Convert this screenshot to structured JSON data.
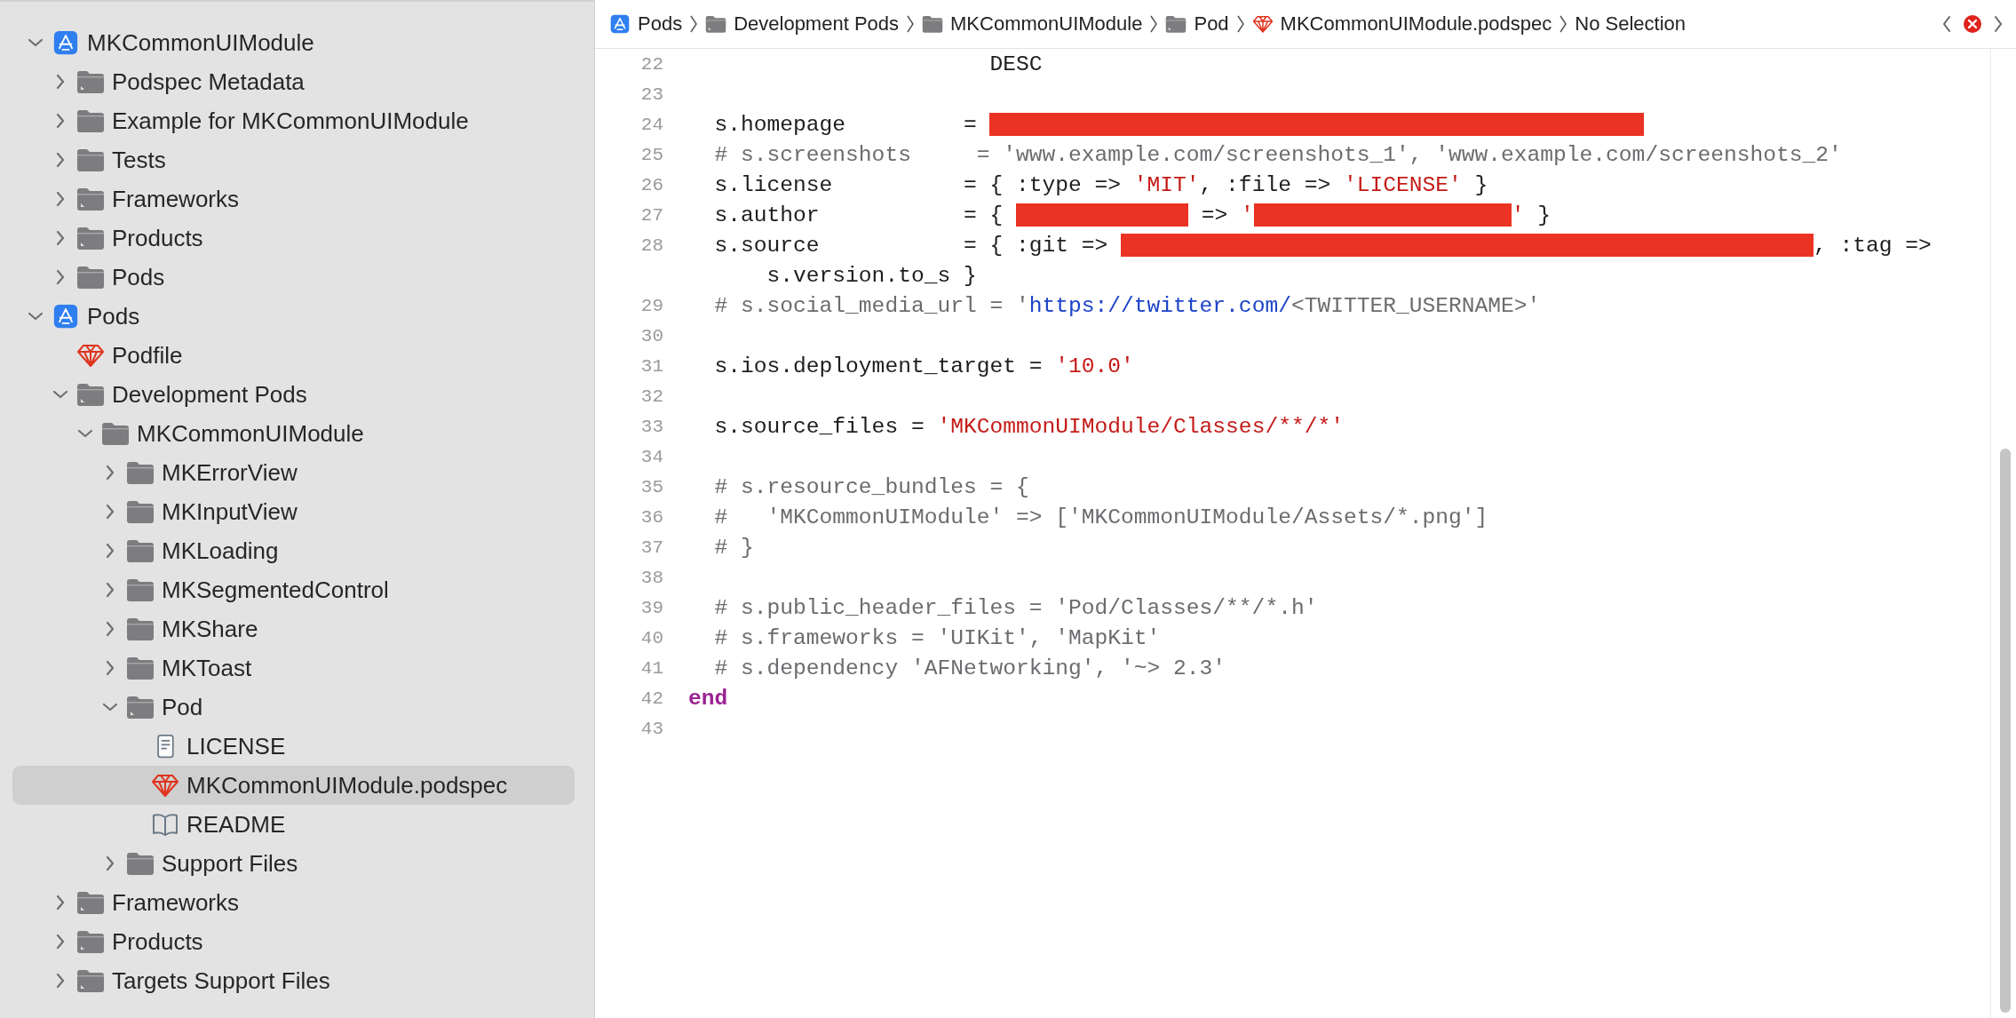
{
  "navigator": {
    "items": [
      {
        "label": "MKCommonUIModule",
        "kind": "project",
        "expanded": true,
        "selected": false,
        "children": [
          {
            "label": "Podspec Metadata",
            "kind": "group",
            "expanded": false,
            "selected": false
          },
          {
            "label": "Example for MKCommonUIModule",
            "kind": "folder",
            "expanded": false,
            "selected": false
          },
          {
            "label": "Tests",
            "kind": "folder",
            "expanded": false,
            "selected": false
          },
          {
            "label": "Frameworks",
            "kind": "group",
            "expanded": false,
            "selected": false
          },
          {
            "label": "Products",
            "kind": "group",
            "expanded": false,
            "selected": false
          },
          {
            "label": "Pods",
            "kind": "folder",
            "expanded": false,
            "selected": false
          }
        ]
      },
      {
        "label": "Pods",
        "kind": "project",
        "expanded": true,
        "selected": false,
        "children": [
          {
            "label": "Podfile",
            "kind": "ruby",
            "selected": false
          },
          {
            "label": "Development Pods",
            "kind": "group",
            "expanded": true,
            "selected": false,
            "children": [
              {
                "label": "MKCommonUIModule",
                "kind": "folder",
                "expanded": true,
                "selected": false,
                "children": [
                  {
                    "label": "MKErrorView",
                    "kind": "folder",
                    "expanded": false,
                    "selected": false
                  },
                  {
                    "label": "MKInputView",
                    "kind": "folder",
                    "expanded": false,
                    "selected": false
                  },
                  {
                    "label": "MKLoading",
                    "kind": "folder",
                    "expanded": false,
                    "selected": false
                  },
                  {
                    "label": "MKSegmentedControl",
                    "kind": "folder",
                    "expanded": false,
                    "selected": false
                  },
                  {
                    "label": "MKShare",
                    "kind": "folder",
                    "expanded": false,
                    "selected": false
                  },
                  {
                    "label": "MKToast",
                    "kind": "folder",
                    "expanded": false,
                    "selected": false
                  },
                  {
                    "label": "Pod",
                    "kind": "group",
                    "expanded": true,
                    "selected": false,
                    "children": [
                      {
                        "label": "LICENSE",
                        "kind": "text",
                        "selected": false
                      },
                      {
                        "label": "MKCommonUIModule.podspec",
                        "kind": "ruby",
                        "selected": true
                      },
                      {
                        "label": "README",
                        "kind": "book",
                        "selected": false
                      }
                    ]
                  },
                  {
                    "label": "Support Files",
                    "kind": "folder",
                    "expanded": false,
                    "selected": false
                  }
                ]
              }
            ]
          },
          {
            "label": "Frameworks",
            "kind": "group",
            "expanded": false,
            "selected": false
          },
          {
            "label": "Products",
            "kind": "group",
            "expanded": false,
            "selected": false
          },
          {
            "label": "Targets Support Files",
            "kind": "group",
            "expanded": false,
            "selected": false
          }
        ]
      }
    ]
  },
  "jump_bar": {
    "path": [
      {
        "label": "Pods",
        "kind": "project"
      },
      {
        "label": "Development Pods",
        "kind": "group"
      },
      {
        "label": "MKCommonUIModule",
        "kind": "folder"
      },
      {
        "label": "Pod",
        "kind": "group"
      },
      {
        "label": "MKCommonUIModule.podspec",
        "kind": "ruby"
      },
      {
        "label": "No Selection"
      }
    ],
    "error": true
  },
  "editor": {
    "lines": [
      {
        "number": "22",
        "segments": [
          {
            "kind": "plain",
            "text": "                       DESC"
          }
        ]
      },
      {
        "number": "23"
      },
      {
        "number": "24",
        "segments": [
          {
            "kind": "plain",
            "text": "  s.homepage         = "
          },
          {
            "kind": "redacted"
          }
        ]
      },
      {
        "number": "25",
        "segments": [
          {
            "kind": "comment",
            "text": "  # s.screenshots     = 'www.example.com/screenshots_1', 'www.example.com/screenshots_2'"
          }
        ]
      },
      {
        "number": "26",
        "segments": [
          {
            "kind": "plain",
            "text": "  s.license          = { :type => "
          },
          {
            "kind": "string",
            "text": "'MIT'"
          },
          {
            "kind": "plain",
            "text": ", :file => "
          },
          {
            "kind": "string",
            "text": "'LICENSE'"
          },
          {
            "kind": "plain",
            "text": " }"
          }
        ]
      },
      {
        "number": "27",
        "segments": [
          {
            "kind": "plain",
            "text": "  s.author           = { "
          },
          {
            "kind": "redacted"
          },
          {
            "kind": "plain",
            "text": " => "
          },
          {
            "kind": "string",
            "text": "'"
          },
          {
            "kind": "redacted"
          },
          {
            "kind": "string",
            "text": "'"
          },
          {
            "kind": "plain",
            "text": " }"
          }
        ]
      },
      {
        "number": "28",
        "segments": [
          {
            "kind": "plain",
            "text": "  s.source           = { :git => "
          },
          {
            "kind": "redacted"
          },
          {
            "kind": "plain",
            "text": ", :tag =>"
          }
        ],
        "wrap": [
          {
            "kind": "plain",
            "text": "      s.version.to_s }"
          }
        ]
      },
      {
        "number": "29",
        "segments": [
          {
            "kind": "comment",
            "text": "  # s.social_media_url = '"
          },
          {
            "kind": "link",
            "text": "https://twitter.com/"
          },
          {
            "kind": "comment",
            "text": "<TWITTER_USERNAME>'"
          }
        ]
      },
      {
        "number": "30"
      },
      {
        "number": "31",
        "segments": [
          {
            "kind": "plain",
            "text": "  s.ios.deployment_target = "
          },
          {
            "kind": "string",
            "text": "'10.0'"
          }
        ]
      },
      {
        "number": "32"
      },
      {
        "number": "33",
        "segments": [
          {
            "kind": "plain",
            "text": "  s.source_files = "
          },
          {
            "kind": "string",
            "text": "'MKCommonUIModule/Classes/**/*'"
          }
        ]
      },
      {
        "number": "34"
      },
      {
        "number": "35",
        "segments": [
          {
            "kind": "comment",
            "text": "  # s.resource_bundles = {"
          }
        ]
      },
      {
        "number": "36",
        "segments": [
          {
            "kind": "comment",
            "text": "  #   'MKCommonUIModule' => ['MKCommonUIModule/Assets/*.png']"
          }
        ]
      },
      {
        "number": "37",
        "segments": [
          {
            "kind": "comment",
            "text": "  # }"
          }
        ]
      },
      {
        "number": "38"
      },
      {
        "number": "39",
        "segments": [
          {
            "kind": "comment",
            "text": "  # s.public_header_files = 'Pod/Classes/**/*.h'"
          }
        ]
      },
      {
        "number": "40",
        "segments": [
          {
            "kind": "comment",
            "text": "  # s.frameworks = 'UIKit', 'MapKit'"
          }
        ]
      },
      {
        "number": "41",
        "segments": [
          {
            "kind": "comment",
            "text": "  # s.dependency 'AFNetworking', '~> 2.3'"
          }
        ]
      },
      {
        "number": "42",
        "segments": [
          {
            "kind": "keyword",
            "text": "end"
          }
        ]
      },
      {
        "number": "43"
      }
    ]
  }
}
